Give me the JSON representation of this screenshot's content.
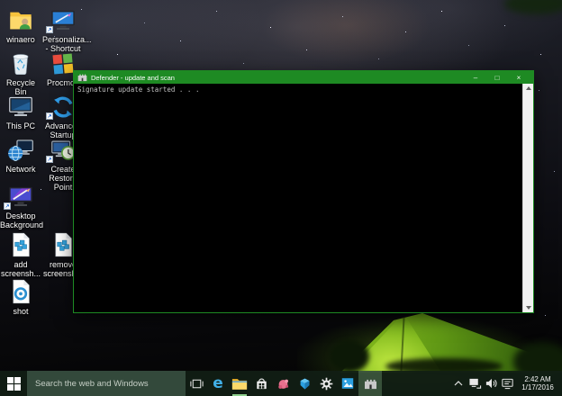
{
  "desktop": {
    "icons": [
      {
        "label": "winaero"
      },
      {
        "label": "Personaliza...\n- Shortcut"
      },
      {
        "label": "Recycle Bin"
      },
      {
        "label": "Procmon"
      },
      {
        "label": "This PC"
      },
      {
        "label": "Advanced\nStartup"
      },
      {
        "label": "Network"
      },
      {
        "label": "Create\nRestore Point"
      },
      {
        "label": "Desktop\nBackground"
      },
      {
        "label": "add\nscreensh..."
      },
      {
        "label": "remove\nscreensh..."
      },
      {
        "label": "shot"
      }
    ]
  },
  "console_window": {
    "title": "Defender - update and scan",
    "output_line": "Signature update started . . .",
    "controls": {
      "minimize": "–",
      "maximize": "□",
      "close": "×"
    }
  },
  "taskbar": {
    "search": {
      "placeholder": "Search the web and Windows"
    },
    "edge_glyph": "e",
    "pinned_icons": [
      "task-view",
      "edge",
      "file-explorer",
      "store",
      "app-pink",
      "app-blue",
      "settings",
      "photos",
      "defender-console"
    ],
    "tray": {
      "time": "2:42 AM",
      "date": "1/17/2016"
    }
  },
  "colors": {
    "title_bar_green": "#1e8a23",
    "taskbar_bg": "#111e14",
    "search_box_bg": "#33493b",
    "tent_green": "#82ba1f",
    "console_bg": "#000000",
    "console_text": "#c0c0c0"
  }
}
